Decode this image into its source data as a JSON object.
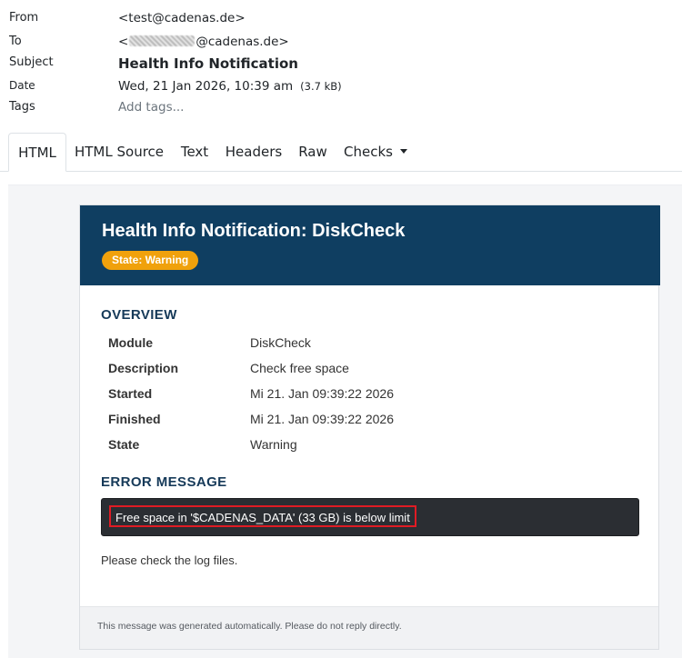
{
  "meta": {
    "from_label": "From",
    "from_value": "<test@cadenas.de>",
    "to_label": "To",
    "to_prefix": "<",
    "to_suffix": "@cadenas.de>",
    "subject_label": "Subject",
    "subject_value": "Health Info Notification",
    "date_label": "Date",
    "date_value": "Wed, 21 Jan 2026, 10:39 am",
    "size_value": "(3.7 kB)",
    "tags_label": "Tags",
    "tags_value": "Add tags..."
  },
  "tabs": [
    {
      "label": "HTML",
      "active": true
    },
    {
      "label": "HTML Source"
    },
    {
      "label": "Text"
    },
    {
      "label": "Headers"
    },
    {
      "label": "Raw"
    },
    {
      "label": "Checks"
    }
  ],
  "email": {
    "title": "Health Info Notification: DiskCheck",
    "state_badge": "State: Warning",
    "overview_title": "OVERVIEW",
    "overview": [
      {
        "key": "Module",
        "value": "DiskCheck"
      },
      {
        "key": "Description",
        "value": "Check free space"
      },
      {
        "key": "Started",
        "value": "Mi 21. Jan 09:39:22 2026"
      },
      {
        "key": "Finished",
        "value": "Mi 21. Jan 09:39:22 2026"
      },
      {
        "key": "State",
        "value": "Warning"
      }
    ],
    "error_title": "ERROR MESSAGE",
    "error_message": "Free space in '$CADENAS_DATA' (33 GB) is below limit",
    "hint": "Please check the log files.",
    "footer": "This message was generated automatically. Please do not reply directly."
  },
  "colors": {
    "header_bg": "#0f3e61",
    "badge_bg": "#f0a10c",
    "error_bg": "#2b2e33",
    "highlight_border": "#e01b24"
  }
}
